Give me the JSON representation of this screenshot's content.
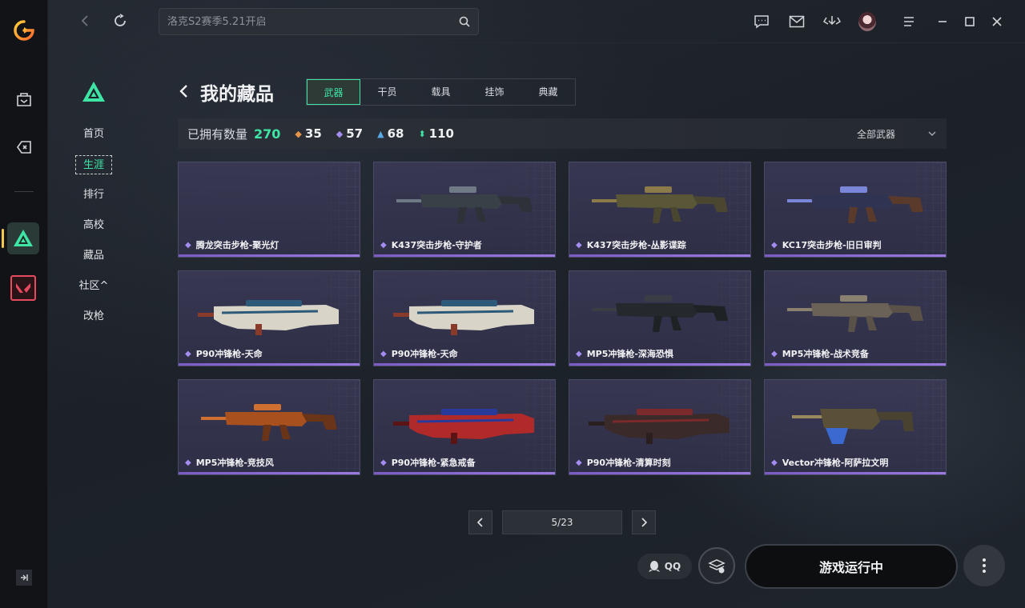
{
  "app": {
    "accent": "#3ee5a4",
    "rarity_purple": "#a58cf0"
  },
  "search": {
    "placeholder": "洛克S2赛季5.21开启"
  },
  "subnav": {
    "items": [
      {
        "label": "首页"
      },
      {
        "label": "生涯"
      },
      {
        "label": "排行"
      },
      {
        "label": "高校"
      },
      {
        "label": "藏品"
      },
      {
        "label": "社区^"
      },
      {
        "label": "改枪"
      }
    ],
    "active_index": 1
  },
  "header": {
    "title": "我的藏品",
    "tabs": [
      {
        "label": "武器"
      },
      {
        "label": "干员"
      },
      {
        "label": "载具"
      },
      {
        "label": "挂饰"
      },
      {
        "label": "典藏"
      }
    ],
    "active_tab": 0
  },
  "stats": {
    "owned_label": "已拥有数量",
    "owned_value": "270",
    "counts": [
      {
        "value": "35",
        "color": "#e8934a"
      },
      {
        "value": "57",
        "color": "#a58cf0"
      },
      {
        "value": "68",
        "color": "#5aa9e6"
      },
      {
        "value": "110",
        "color": "#3ee5a4"
      }
    ],
    "filter_label": "全部武器"
  },
  "items": [
    {
      "name": "腾龙突击步枪-聚光灯",
      "gun": "none"
    },
    {
      "name": "K437突击步枪-守护者",
      "gun": "rifle-dark"
    },
    {
      "name": "K437突击步枪-丛影谍踪",
      "gun": "rifle-camo"
    },
    {
      "name": "KC17突击步枪-旧日审判",
      "gun": "rifle-blue"
    },
    {
      "name": "P90冲锋枪-天命",
      "gun": "p90-art"
    },
    {
      "name": "P90冲锋枪-天命",
      "gun": "p90-art"
    },
    {
      "name": "MP5冲锋枪-深海恐惧",
      "gun": "mp5-dark"
    },
    {
      "name": "MP5冲锋枪-战术竞备",
      "gun": "mp5-tan"
    },
    {
      "name": "MP5冲锋枪-竞技风",
      "gun": "mp5-orange"
    },
    {
      "name": "P90冲锋枪-紧急戒备",
      "gun": "p90-red"
    },
    {
      "name": "P90冲锋枪-清算时刻",
      "gun": "p90-maroon"
    },
    {
      "name": "Vector冲锋枪-阿萨拉文明",
      "gun": "vector"
    }
  ],
  "pagination": {
    "current": "5/23"
  },
  "bottom": {
    "qq_label": "QQ",
    "run_label": "游戏运行中"
  }
}
